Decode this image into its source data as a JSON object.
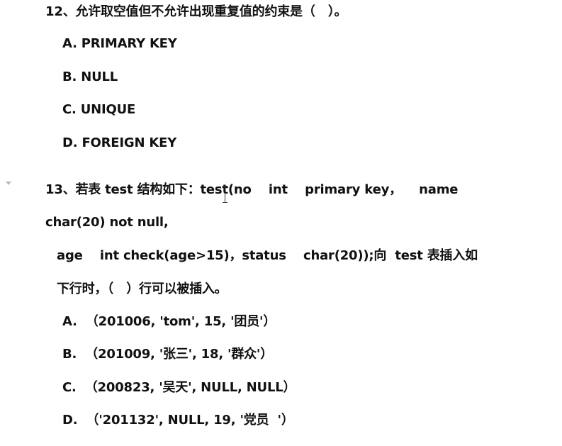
{
  "q12": {
    "stem": "12、允许取空值但不允许出现重复值的约束是（   ）。",
    "options": [
      "A. PRIMARY KEY",
      "B. NULL",
      "C. UNIQUE",
      "D. FOREIGN KEY"
    ]
  },
  "q13": {
    "stem_lines": [
      "13、若表 test 结构如下：test(no    int    primary key，    name",
      "char(20) not null,",
      "age    int check(age>15)，status    char(20));向  test 表插入如",
      "下行时，（   ）行可以被插入。"
    ],
    "options": [
      "A.  （201006, 'tom', 15, '团员'）",
      "B.  （201009, '张三', 18, '群众'）",
      "C.  （200823, '吴天', NULL, NULL）",
      "D.  （'201132', NULL, 19, '党员  '）"
    ]
  }
}
